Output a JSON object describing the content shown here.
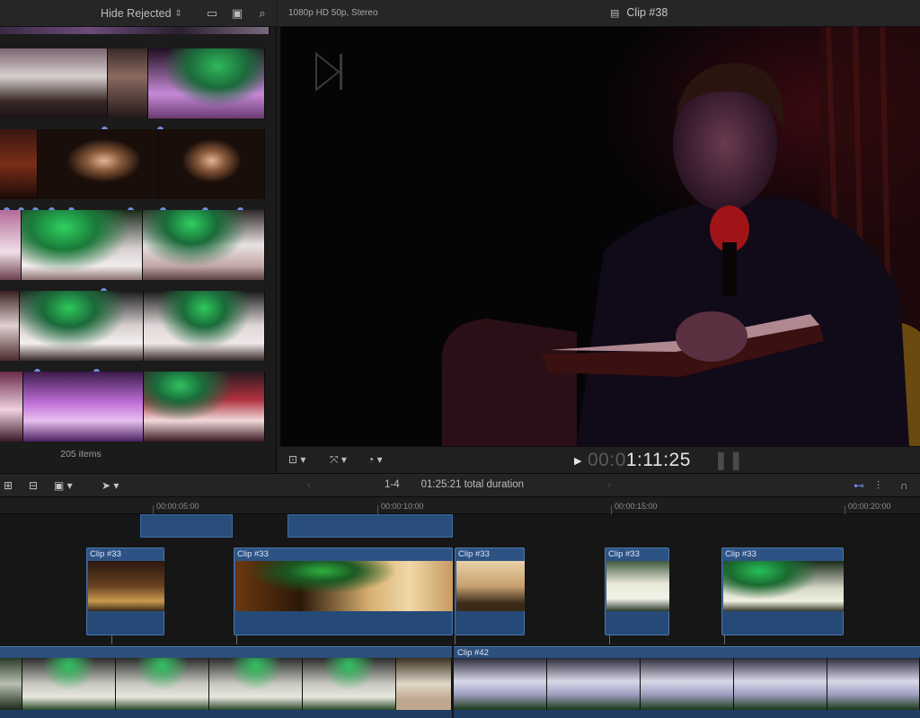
{
  "browser": {
    "filter_label": "Hide Rejected",
    "item_count": "205 items"
  },
  "viewer": {
    "format_label": "1080p HD 50p, Stereo",
    "clip_title": "Clip #38",
    "timecode_dim": "00:0",
    "timecode_bright": "1:11:25"
  },
  "timeline_toolbar": {
    "range": "1-4",
    "duration": "01:25:21 total duration"
  },
  "ruler": {
    "ticks": [
      "00:00:05:00",
      "00:00:10:00",
      "00:00:15:00",
      "00:00:20:00"
    ]
  },
  "connected_clips": [
    {
      "label": "Clip #33"
    },
    {
      "label": "Clip #33"
    },
    {
      "label": "Clip #33"
    },
    {
      "label": "Clip #33"
    },
    {
      "label": "Clip #33"
    }
  ],
  "primary_storyline": {
    "clip_label": "Clip #42"
  },
  "icons": {
    "accent": "#5b7fe6",
    "active": "#6d8cf0"
  }
}
